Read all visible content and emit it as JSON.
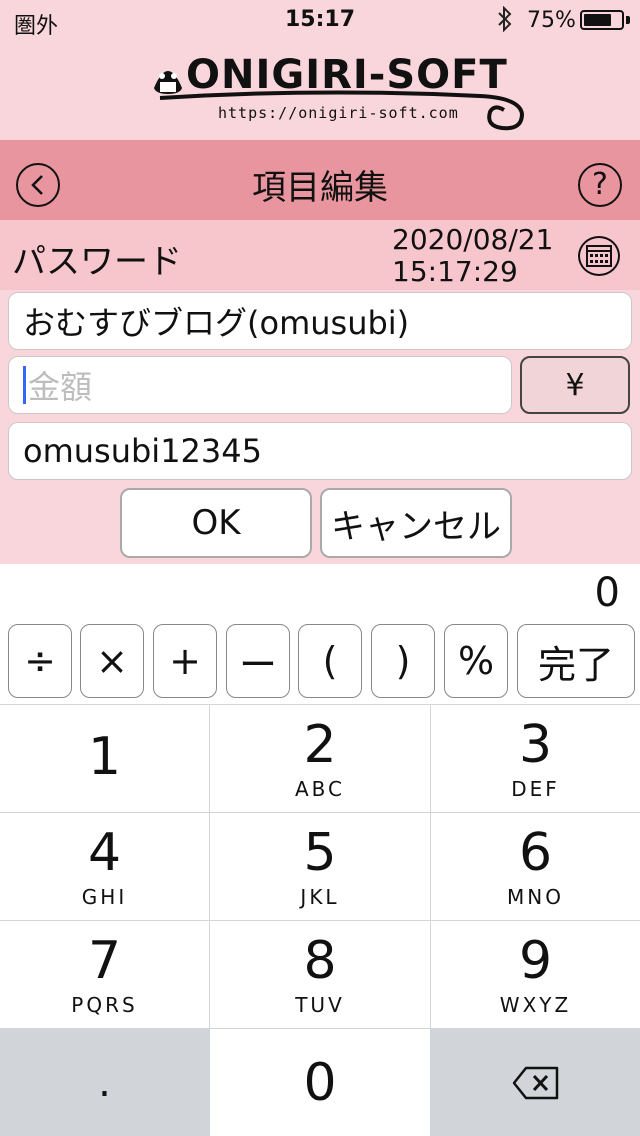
{
  "status_bar": {
    "carrier": "圏外",
    "time": "15:17",
    "battery_text": "75%",
    "battery_level": 0.75
  },
  "logo": {
    "name": "ONIGIRI-SOFT",
    "url": "https://onigiri-soft.com"
  },
  "nav": {
    "title": "項目編集",
    "help_label": "?"
  },
  "entry": {
    "category": "パスワード",
    "date": "2020/08/21",
    "time": "15:17:29"
  },
  "fields": {
    "name_value": "おむすびブログ(omusubi)",
    "amount_placeholder": "金額",
    "currency_label": "¥",
    "memo_value": "omusubi12345"
  },
  "actions": {
    "ok_label": "OK",
    "cancel_label": "キャンセル"
  },
  "calculator": {
    "display": "0",
    "ops": [
      "÷",
      "×",
      "+",
      "ー",
      "(",
      ")",
      "%"
    ],
    "done_label": "完了"
  },
  "keypad": {
    "keys": [
      {
        "digit": "1",
        "letters": ""
      },
      {
        "digit": "2",
        "letters": "ABC"
      },
      {
        "digit": "3",
        "letters": "DEF"
      },
      {
        "digit": "4",
        "letters": "GHI"
      },
      {
        "digit": "5",
        "letters": "JKL"
      },
      {
        "digit": "6",
        "letters": "MNO"
      },
      {
        "digit": "7",
        "letters": "PQRS"
      },
      {
        "digit": "8",
        "letters": "TUV"
      },
      {
        "digit": "9",
        "letters": "WXYZ"
      }
    ],
    "decimal": ".",
    "zero": "0"
  }
}
